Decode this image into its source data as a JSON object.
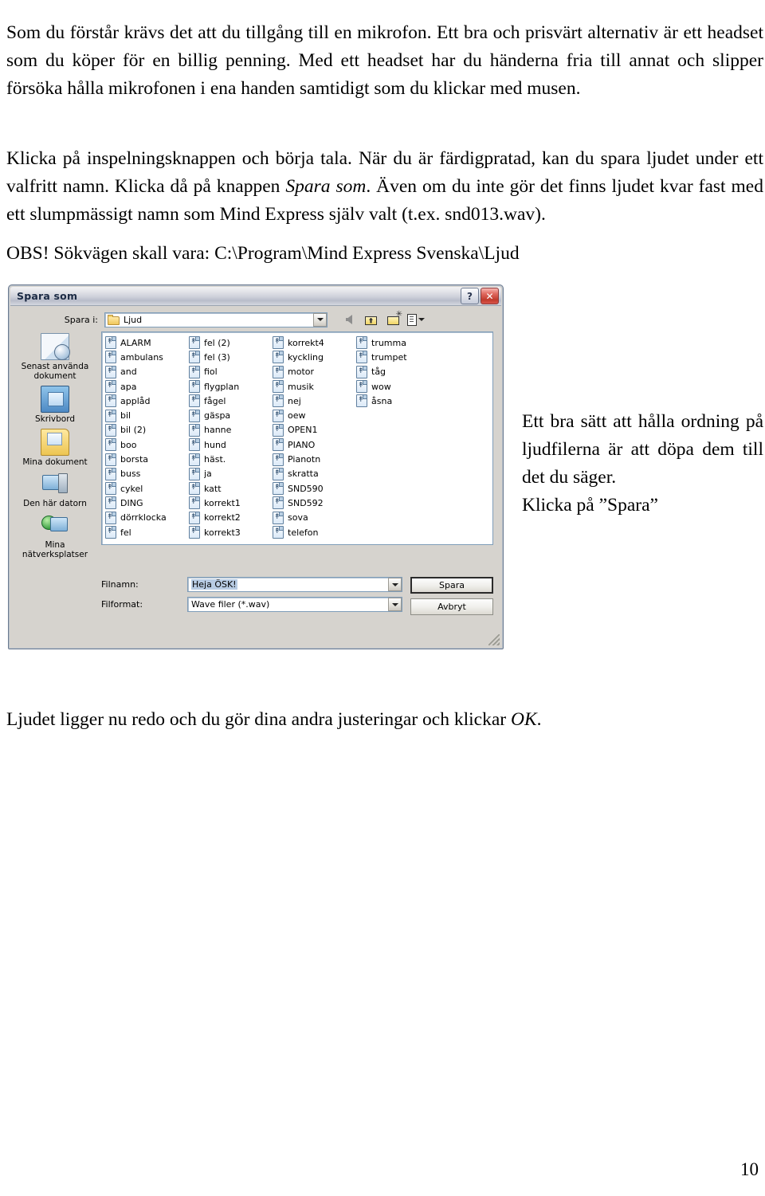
{
  "document": {
    "paragraph_1": "Som du förstår krävs det att du tillgång till en mikrofon. Ett bra och prisvärt alternativ är ett headset som du köper för en billig penning. Med ett headset har du händerna fria till annat och slipper försöka hålla mikrofonen i ena handen samtidigt som du klickar med musen.",
    "paragraph_2_part1": "Klicka på inspelningsknappen och börja tala. När du är färdigpratad, kan du spara ljudet under ett valfritt namn. Klicka då på knappen ",
    "paragraph_2_italic": "Spara som",
    "paragraph_2_part2": ". Även om du inte gör det finns ljudet kvar fast med ett slumpmässigt namn som Mind Express själv valt (t.ex. snd013.wav).",
    "paragraph_3": "OBS! Sökvägen skall vara: C:\\Program\\Mind Express Svenska\\Ljud",
    "callout_1": "Ett bra sätt att hålla ordning på ljudfilerna är att döpa dem till det du säger.",
    "callout_2": "Klicka på ”Spara”",
    "bottom_part1": "Ljudet ligger nu redo och du gör dina andra justeringar och klickar ",
    "bottom_italic": "OK",
    "bottom_part2": ".",
    "page_number": "10"
  },
  "dialog": {
    "title": "Spara som",
    "help_button": "?",
    "close_button": "✕",
    "lookin": {
      "label": "Spara i:",
      "value": "Ljud"
    },
    "toolbar": {
      "back": "back-arrow",
      "up": "up-one-level",
      "new_folder": "create-new-folder",
      "views": "views-menu"
    },
    "places": [
      {
        "label": "Senast använda dokument",
        "icon": "recent-documents-icon"
      },
      {
        "label": "Skrivbord",
        "icon": "desktop-icon"
      },
      {
        "label": "Mina dokument",
        "icon": "my-documents-icon"
      },
      {
        "label": "Den här datorn",
        "icon": "my-computer-icon"
      },
      {
        "label": "Mina nätverksplatser",
        "icon": "my-network-places-icon"
      }
    ],
    "files": [
      "ALARM",
      "ambulans",
      "and",
      "apa",
      "applåd",
      "bil",
      "bil (2)",
      "boo",
      "borsta",
      "buss",
      "cykel",
      "DING",
      "dörrklocka",
      "fel",
      "fel (2)",
      "fel (3)",
      "fiol",
      "flygplan",
      "fågel",
      "gäspa",
      "hanne",
      "hund",
      "häst.",
      "ja",
      "katt",
      "korrekt1",
      "korrekt2",
      "korrekt3",
      "korrekt4",
      "kyckling",
      "motor",
      "musik",
      "nej",
      "oew",
      "OPEN1",
      "PIANO",
      "Pianotn",
      "skratta",
      "SND590",
      "SND592",
      "sova",
      "telefon",
      "trumma",
      "trumpet",
      "tåg",
      "wow",
      "åsna"
    ],
    "filename": {
      "label": "Filnamn:",
      "value": "Heja ÖSK!"
    },
    "filetype": {
      "label": "Filformat:",
      "value": "Wave filer (*.wav)"
    },
    "buttons": {
      "save": "Spara",
      "cancel": "Avbryt"
    }
  },
  "colors": {
    "dialog_face": "#d6d3ce",
    "field_border": "#7f9db9",
    "close_red": "#c03a2c",
    "selection_blue": "#b8cce4"
  }
}
